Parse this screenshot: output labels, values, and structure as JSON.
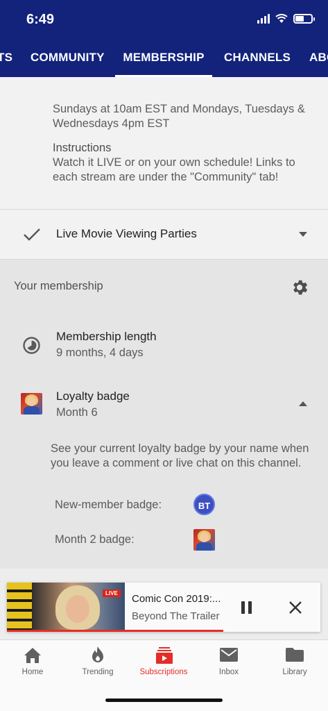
{
  "status_bar": {
    "time": "6:49"
  },
  "tabs": [
    {
      "label": "TS",
      "active": false
    },
    {
      "label": "COMMUNITY",
      "active": false
    },
    {
      "label": "MEMBERSHIP",
      "active": true
    },
    {
      "label": "CHANNELS",
      "active": false
    },
    {
      "label": "ABO",
      "active": false
    }
  ],
  "info": {
    "schedule": "Sundays at 10am EST and Mondays, Tuesdays & Wednesdays 4pm EST",
    "instructions_heading": "Instructions",
    "instructions_text": "Watch it LIVE or on your own schedule! Links to each stream are under the \"Community\" tab!"
  },
  "perk": {
    "label": "Live Movie Viewing Parties",
    "icon": "checkmark-icon"
  },
  "membership": {
    "title": "Your membership",
    "length_title": "Membership length",
    "length_value": "9 months, 4 days",
    "loyalty_title": "Loyalty badge",
    "loyalty_value": "Month 6",
    "loyalty_description": "See your current loyalty badge by your name when you leave a comment or live chat on this channel.",
    "new_member_badge_label": "New-member badge:",
    "new_member_badge_text": "BT",
    "month2_badge_label": "Month 2 badge:"
  },
  "mini_player": {
    "title": "Comic Con 2019:...",
    "channel": "Beyond The Trailer",
    "live_tag": "LIVE",
    "progress": 0.69
  },
  "bottom_nav": [
    {
      "label": "Home",
      "icon": "home-icon",
      "active": false
    },
    {
      "label": "Trending",
      "icon": "flame-icon",
      "active": false
    },
    {
      "label": "Subscriptions",
      "icon": "subscriptions-icon",
      "active": true
    },
    {
      "label": "Inbox",
      "icon": "mail-icon",
      "active": false
    },
    {
      "label": "Library",
      "icon": "folder-icon",
      "active": false
    }
  ],
  "colors": {
    "header": "#13237c",
    "accent": "#e52d27"
  }
}
